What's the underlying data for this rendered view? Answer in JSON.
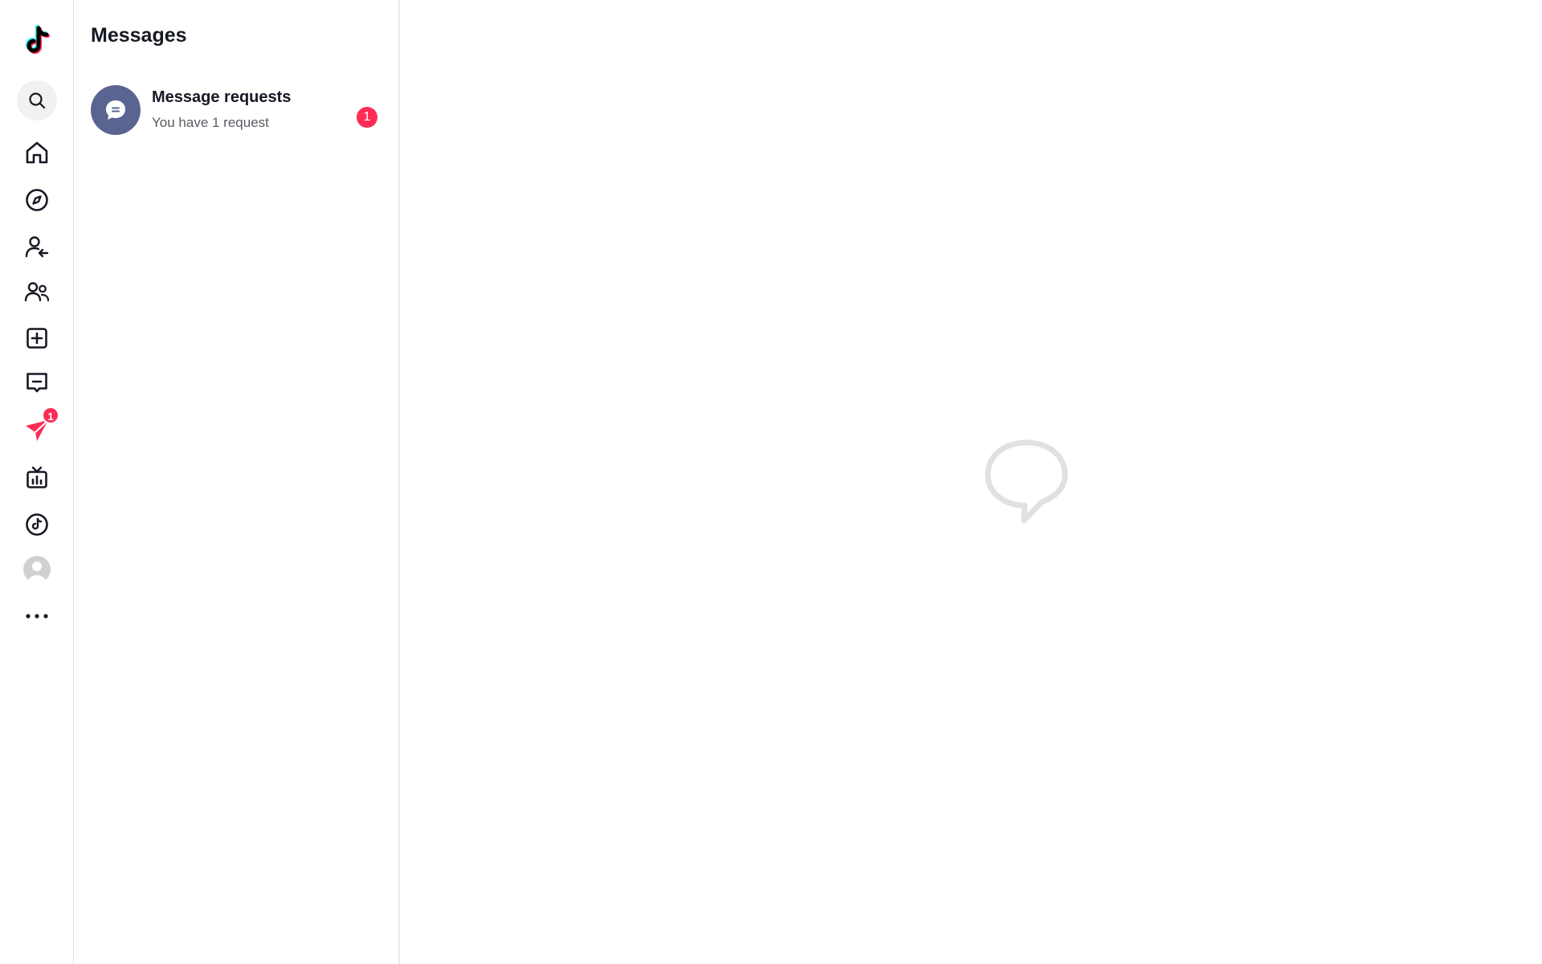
{
  "rail": {
    "items": [
      {
        "name": "logo-icon"
      },
      {
        "name": "search-icon"
      },
      {
        "name": "home-icon"
      },
      {
        "name": "explore-icon"
      },
      {
        "name": "following-icon"
      },
      {
        "name": "friends-icon"
      },
      {
        "name": "upload-icon"
      },
      {
        "name": "inbox-icon"
      },
      {
        "name": "messages-icon",
        "badge": "1"
      },
      {
        "name": "live-icon"
      },
      {
        "name": "tiktok-studio-icon"
      },
      {
        "name": "profile-avatar-icon"
      },
      {
        "name": "more-icon"
      }
    ],
    "accent_color": "#fe2c55"
  },
  "panel": {
    "title": "Messages",
    "request": {
      "title": "Message requests",
      "subtitle": "You have 1 request",
      "badge": "1",
      "avatar_color": "#5a6490"
    }
  },
  "main": {
    "empty_state_icon": "chat-bubble-icon"
  }
}
